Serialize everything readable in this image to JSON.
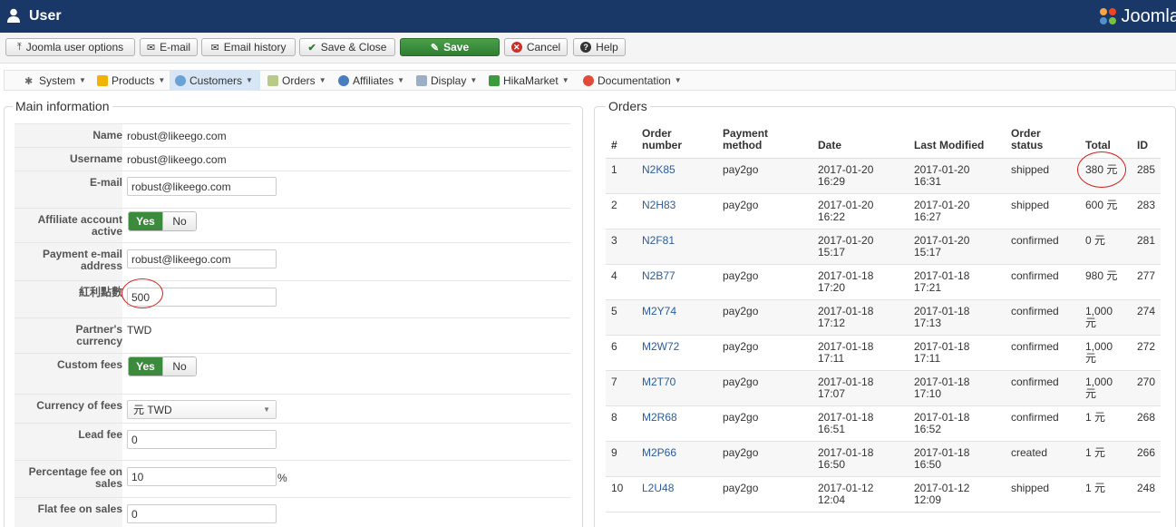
{
  "header": {
    "title": "User",
    "brand": "Joomla"
  },
  "toolbar": {
    "buttons": [
      {
        "label": "Joomla user options",
        "icon": "upload-icon"
      },
      {
        "label": "E-mail",
        "icon": "envelope-icon"
      },
      {
        "label": "Email history",
        "icon": "envelope-icon"
      },
      {
        "label": "Save & Close",
        "icon": "check-icon"
      },
      {
        "label": "Save",
        "icon": "edit-icon"
      },
      {
        "label": "Cancel",
        "icon": "cancel-icon"
      },
      {
        "label": "Help",
        "icon": "question-icon"
      }
    ]
  },
  "menu": [
    {
      "label": "System"
    },
    {
      "label": "Products"
    },
    {
      "label": "Customers"
    },
    {
      "label": "Orders"
    },
    {
      "label": "Affiliates"
    },
    {
      "label": "Display"
    },
    {
      "label": "HikaMarket"
    },
    {
      "label": "Documentation"
    }
  ],
  "main": {
    "legend": "Main information",
    "name_label": "Name",
    "name_value": "robust@likeego.com",
    "username_label": "Username",
    "username_value": "robust@likeego.com",
    "email_label": "E-mail",
    "email_value": "robust@likeego.com",
    "affiliate_label_1": "Affiliate account",
    "affiliate_label_2": "active",
    "payment_email_label_1": "Payment e-mail",
    "payment_email_label_2": "address",
    "payment_email_value": "robust@likeego.com",
    "bonus_label": "紅利點數",
    "bonus_value": "500",
    "currency_label_1": "Partner's",
    "currency_label_2": "currency",
    "currency_value": "TWD",
    "custom_fees_label": "Custom fees",
    "yes_label": "Yes",
    "no_label": "No",
    "currency_fees_label": "Currency of fees",
    "currency_fees_value": "元 TWD",
    "lead_fee_label": "Lead fee",
    "lead_fee_value": "0",
    "pct_fee_label_1": "Percentage fee on",
    "pct_fee_label_2": "sales",
    "pct_fee_value": "10",
    "pct_symbol": "%",
    "flat_fee_label": "Flat fee on sales",
    "flat_fee_value": "0"
  },
  "orders": {
    "legend": "Orders",
    "headers": {
      "num": "#",
      "order_number_1": "Order",
      "order_number_2": "number",
      "payment_1": "Payment",
      "payment_2": "method",
      "date": "Date",
      "modified": "Last Modified",
      "status_1": "Order",
      "status_2": "status",
      "total": "Total",
      "id": "ID"
    },
    "rows": [
      {
        "num": "1",
        "order": "N2K85",
        "payment": "pay2go",
        "date1": "2017-01-20",
        "date2": "16:29",
        "mod1": "2017-01-20",
        "mod2": "16:31",
        "status": "shipped",
        "total1": "380 元",
        "total2": "",
        "id": "285"
      },
      {
        "num": "2",
        "order": "N2H83",
        "payment": "pay2go",
        "date1": "2017-01-20",
        "date2": "16:22",
        "mod1": "2017-01-20",
        "mod2": "16:27",
        "status": "shipped",
        "total1": "600 元",
        "total2": "",
        "id": "283"
      },
      {
        "num": "3",
        "order": "N2F81",
        "payment": "",
        "date1": "2017-01-20",
        "date2": "15:17",
        "mod1": "2017-01-20",
        "mod2": "15:17",
        "status": "confirmed",
        "total1": "0 元",
        "total2": "",
        "id": "281"
      },
      {
        "num": "4",
        "order": "N2B77",
        "payment": "pay2go",
        "date1": "2017-01-18",
        "date2": "17:20",
        "mod1": "2017-01-18",
        "mod2": "17:21",
        "status": "confirmed",
        "total1": "980 元",
        "total2": "",
        "id": "277"
      },
      {
        "num": "5",
        "order": "M2Y74",
        "payment": "pay2go",
        "date1": "2017-01-18",
        "date2": "17:12",
        "mod1": "2017-01-18",
        "mod2": "17:13",
        "status": "confirmed",
        "total1": "1,000",
        "total2": "元",
        "id": "274"
      },
      {
        "num": "6",
        "order": "M2W72",
        "payment": "pay2go",
        "date1": "2017-01-18",
        "date2": "17:11",
        "mod1": "2017-01-18",
        "mod2": "17:11",
        "status": "confirmed",
        "total1": "1,000",
        "total2": "元",
        "id": "272"
      },
      {
        "num": "7",
        "order": "M2T70",
        "payment": "pay2go",
        "date1": "2017-01-18",
        "date2": "17:07",
        "mod1": "2017-01-18",
        "mod2": "17:10",
        "status": "confirmed",
        "total1": "1,000",
        "total2": "元",
        "id": "270"
      },
      {
        "num": "8",
        "order": "M2R68",
        "payment": "pay2go",
        "date1": "2017-01-18",
        "date2": "16:51",
        "mod1": "2017-01-18",
        "mod2": "16:52",
        "status": "confirmed",
        "total1": "1 元",
        "total2": "",
        "id": "268"
      },
      {
        "num": "9",
        "order": "M2P66",
        "payment": "pay2go",
        "date1": "2017-01-18",
        "date2": "16:50",
        "mod1": "2017-01-18",
        "mod2": "16:50",
        "status": "created",
        "total1": "1 元",
        "total2": "",
        "id": "266"
      },
      {
        "num": "10",
        "order": "L2U48",
        "payment": "pay2go",
        "date1": "2017-01-12",
        "date2": "12:04",
        "mod1": "2017-01-12",
        "mod2": "12:09",
        "status": "shipped",
        "total1": "1 元",
        "total2": "",
        "id": "248"
      }
    ]
  },
  "colors": {
    "header_bg": "#1a3867",
    "save_green": "#3c8a3c",
    "link": "#2a5d9c",
    "annotation_red": "#d21f1f"
  }
}
